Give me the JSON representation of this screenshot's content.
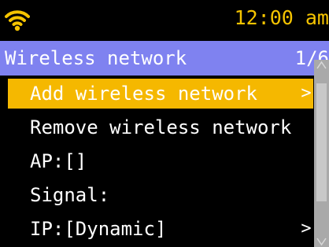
{
  "status_bar": {
    "wifi_icon": "wifi-icon",
    "time": "12:00 am"
  },
  "title_bar": {
    "title": "Wireless network",
    "page": "1/6"
  },
  "menu": {
    "items": [
      {
        "label": "Add wireless network",
        "chevron": ">",
        "selected": true
      },
      {
        "label": "Remove wireless network",
        "chevron": "",
        "selected": false
      },
      {
        "label": "AP:[]",
        "chevron": "",
        "selected": false
      },
      {
        "label": "Signal:",
        "chevron": "",
        "selected": false
      },
      {
        "label": "IP:[Dynamic]",
        "chevron": ">",
        "selected": false
      }
    ]
  },
  "colors": {
    "background": "#000000",
    "accent": "#f5b800",
    "title_bar": "#7f82f0",
    "clock_text": "#f5c400",
    "text": "#ffffff",
    "scrollbar": "#a9a9a9"
  }
}
